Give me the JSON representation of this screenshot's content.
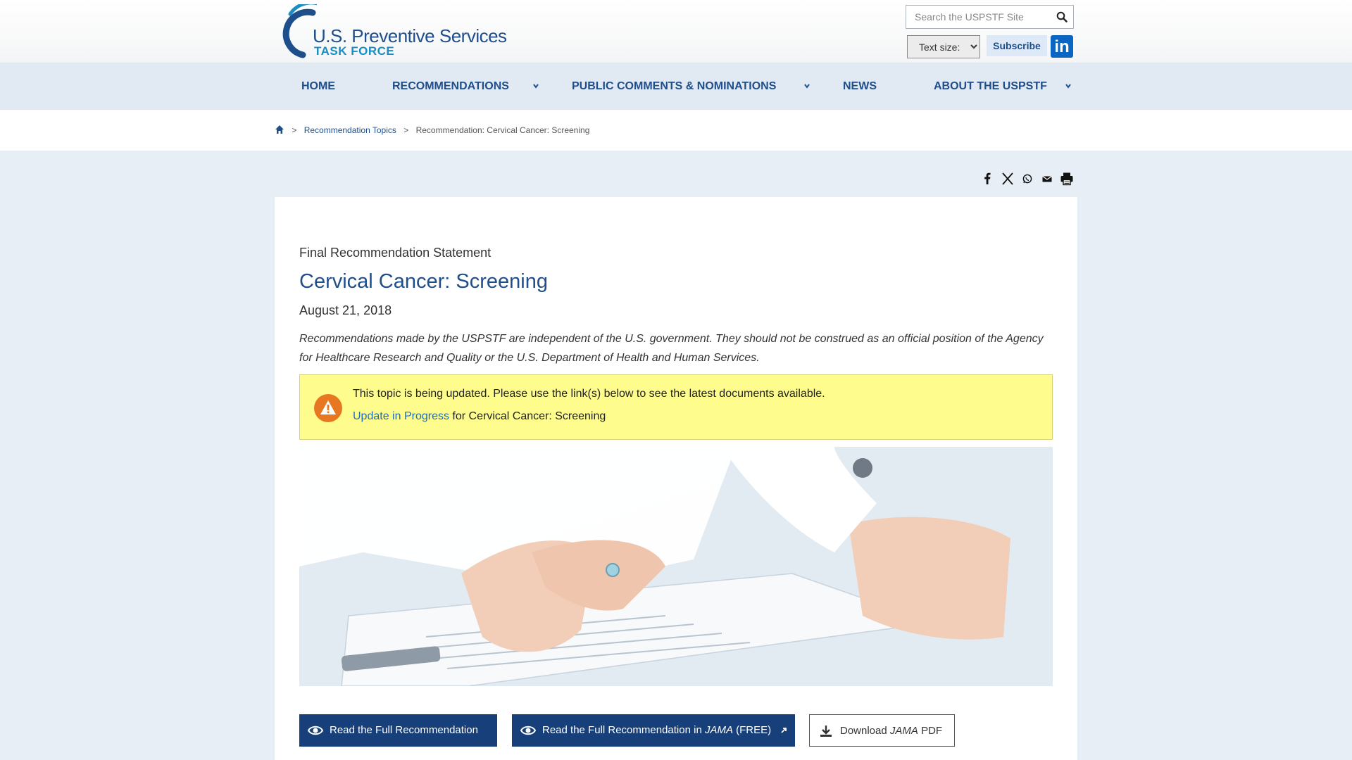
{
  "header": {
    "logo": {
      "line1": "U.S. Preventive Services",
      "line2": "TASK FORCE"
    },
    "search_placeholder": "Search the USPSTF Site",
    "text_size_label": "Text size:",
    "subscribe_label": "Subscribe",
    "linkedin_label": "in"
  },
  "nav": {
    "items": [
      {
        "label": "HOME"
      },
      {
        "label": "RECOMMENDATIONS"
      },
      {
        "label": "PUBLIC COMMENTS & NOMINATIONS"
      },
      {
        "label": "NEWS"
      },
      {
        "label": "ABOUT THE USPSTF"
      }
    ]
  },
  "breadcrumb": {
    "separator": ">",
    "items": [
      "Recommendation Topics",
      "Recommendation: Cervical Cancer: Screening"
    ]
  },
  "share": {
    "icons": [
      "facebook-icon",
      "x-icon",
      "whatsapp-icon",
      "email-icon",
      "print-icon"
    ]
  },
  "content": {
    "kicker": "Final Recommendation Statement",
    "title": "Cervical Cancer: Screening",
    "date": "August 21, 2018",
    "disclaimer": "Recommendations made by the USPSTF are independent of the U.S. government. They should not be construed as an official position of the Agency for Healthcare Research and Quality or the U.S. Department of Health and Human Services.",
    "alert": {
      "message": "This topic is being updated. Please use the link(s) below to see the latest documents available.",
      "link_text": "Update in Progress",
      "link_suffix": " for Cervical Cancer: Screening"
    },
    "buttons": {
      "read_full": "Read the Full Recommendation",
      "read_jama_prefix": "Read the Full Recommendation in ",
      "read_jama_journal": "JAMA",
      "read_jama_suffix": " (FREE)",
      "download_prefix": "Download ",
      "download_journal": "JAMA",
      "download_suffix": " PDF"
    }
  },
  "colors": {
    "brand_blue": "#1f4e8c",
    "button_blue": "#173f7a",
    "alert_yellow": "#fdfc8d",
    "alert_orange": "#e87722",
    "page_bg": "#e8eef5"
  }
}
